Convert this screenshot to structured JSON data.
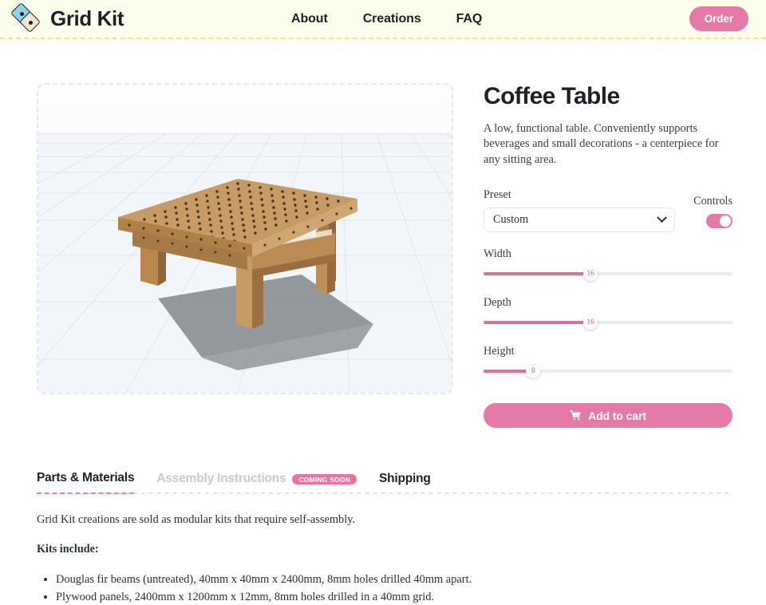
{
  "header": {
    "brand_name": "Grid Kit",
    "logo_icon": "diamond-grid-logo",
    "nav": [
      {
        "label": "About"
      },
      {
        "label": "Creations"
      },
      {
        "label": "FAQ"
      }
    ],
    "order_label": "Order",
    "accent_pink": "#e57aa8",
    "background": "#fdfdeb",
    "border_color": "#f3e38a"
  },
  "viewport": {
    "model_name": "coffee-table-3d-model",
    "wood_color": "#c79b65",
    "floor_color": "#f4f7f9",
    "shadow_color": "#808487"
  },
  "product": {
    "title": "Coffee Table",
    "description": "A low, functional table. Conveniently supports beverages and small decorations - a centerpiece for any sitting area.",
    "preset_label": "Preset",
    "preset_value": "Custom",
    "preset_options": [
      "Custom"
    ],
    "controls_label": "Controls",
    "controls_enabled": true,
    "sliders": [
      {
        "label": "Width",
        "value": "16",
        "percent": 43
      },
      {
        "label": "Depth",
        "value": "16",
        "percent": 43
      },
      {
        "label": "Height",
        "value": "8",
        "percent": 20
      }
    ],
    "add_to_cart_label": "Add to cart",
    "cart_icon": "shopping-cart-icon"
  },
  "tabs": [
    {
      "label": "Parts & Materials",
      "active": true,
      "disabled": false,
      "badge": null
    },
    {
      "label": "Assembly Instructions",
      "active": false,
      "disabled": true,
      "badge": "COMING SOON"
    },
    {
      "label": "Shipping",
      "active": false,
      "disabled": false,
      "badge": null
    }
  ],
  "tab_body": {
    "intro": "Grid Kit creations are sold as modular kits that require self-assembly.",
    "kits_include_heading": "Kits include:",
    "kit_items": [
      "Douglas fir beams (untreated), 40mm x 40mm x 2400mm, 8mm holes drilled 40mm apart.",
      "Plywood panels, 2400mm x 1200mm x 12mm, 8mm holes drilled in a 40mm grid."
    ]
  }
}
